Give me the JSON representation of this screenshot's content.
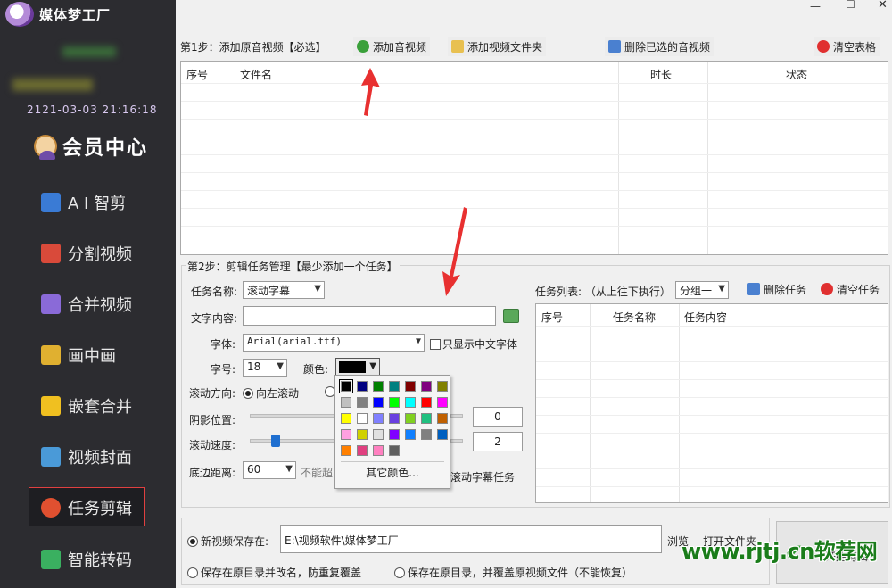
{
  "app": {
    "title": "媒体梦工厂",
    "expire": "2121-03-03 21:16:18"
  },
  "vip": {
    "label": "会员中心"
  },
  "nav": [
    {
      "label": "A I 智剪",
      "color": "#3a7bd5"
    },
    {
      "label": "分割视频",
      "color": "#d94a3a"
    },
    {
      "label": "合并视频",
      "color": "#8a6ad8"
    },
    {
      "label": "画中画",
      "color": "#e0b030"
    },
    {
      "label": "嵌套合并",
      "color": "#f0c020"
    },
    {
      "label": "视频封面",
      "color": "#4a9ad8"
    },
    {
      "label": "任务剪辑",
      "color": "#e05030"
    },
    {
      "label": "智能转码",
      "color": "#3ab060"
    }
  ],
  "window": {
    "min": "—",
    "max": "☐",
    "close": "✕"
  },
  "step1": {
    "label": "第1步：添加原音视频【必选】",
    "add_av": "添加音视频",
    "add_folder": "添加视频文件夹",
    "delete_selected": "删除已选的音视频",
    "clear_table": "清空表格",
    "columns": [
      "序号",
      "文件名",
      "时长",
      "状态"
    ]
  },
  "step2": {
    "label": "第2步：剪辑任务管理【最少添加一个任务】",
    "task_name_label": "任务名称:",
    "task_name_value": "滚动字幕",
    "text_label": "文字内容:",
    "text_value": "",
    "font_label": "字体:",
    "font_value": "Arial(arial.ttf)",
    "chinese_only_label": "只显示中文字体",
    "size_label": "字号:",
    "size_value": "18",
    "color_label": "颜色:",
    "direction_label": "滚动方向:",
    "direction_left": "向左滚动",
    "shadow_label": "阴影位置:",
    "shadow_value": "0",
    "speed_label": "滚动速度:",
    "speed_value": "2",
    "speed_level": 0.12,
    "bottom_label": "底边距离:",
    "bottom_value": "60",
    "bottom_hint": "不能超",
    "add_task_btn": "滚动字幕任务",
    "task_list_label": "任务列表: （从上往下执行）",
    "group_value": "分组一",
    "delete_task": "删除任务",
    "clear_task": "清空任务",
    "task_columns": [
      "序号",
      "任务名称",
      "任务内容"
    ],
    "more_colors": "其它颜色..."
  },
  "palette": [
    [
      "#000000",
      "#000080",
      "#008000",
      "#008080",
      "#800000",
      "#800080",
      "#808000"
    ],
    [
      "#c0c0c0",
      "#808080",
      "#0000ff",
      "#00ff00",
      "#00ffff",
      "#ff0000",
      "#ff00ff"
    ],
    [
      "#ffff00",
      "#ffffff",
      "#8080ff",
      "#6a40e0",
      "#80d020",
      "#20c080",
      "#c06000"
    ],
    [
      "#ffa0e0",
      "#d0d000",
      "#e0e0e0",
      "#8000ff",
      "#1080ff",
      "#808080",
      "#0060c0"
    ],
    [
      "#ff8000",
      "#e04080",
      "#ff80c0",
      "#606060"
    ]
  ],
  "bottom": {
    "save_new_label": "新视频保存在:",
    "save_path": "E:\\视频软件\\媒体梦工厂",
    "browse": "浏览",
    "open_folder": "打开文件夹",
    "opt_rename": "保存在原目录并改名，防重复覆盖",
    "opt_overwrite": "保存在原目录，并覆盖原视频文件（不能恢复）",
    "start": "开始剪辑"
  },
  "watermark": "www.rjtj.cn软荐网"
}
